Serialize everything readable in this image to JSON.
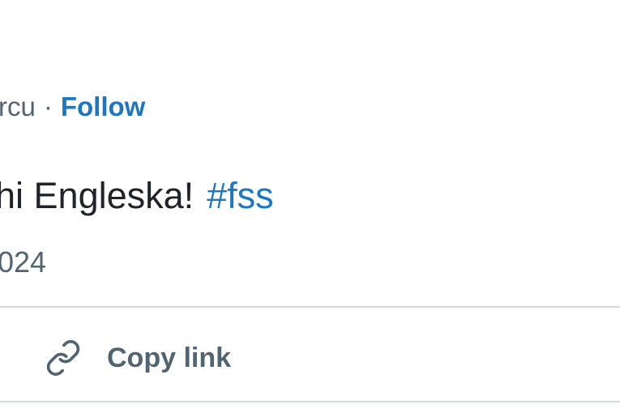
{
  "tweet": {
    "author_tail": "rcu",
    "separator": "·",
    "follow_label": "Follow",
    "text": "hi Engleska!",
    "hashtag": "#fss",
    "timestamp_tail": "024"
  },
  "actions": {
    "copy_link_label": "Copy link",
    "copy_link_icon": "link-icon"
  },
  "colors": {
    "accent": "#1d78c3",
    "text": "#202327",
    "muted": "#536471",
    "divider": "#cfd9de"
  }
}
